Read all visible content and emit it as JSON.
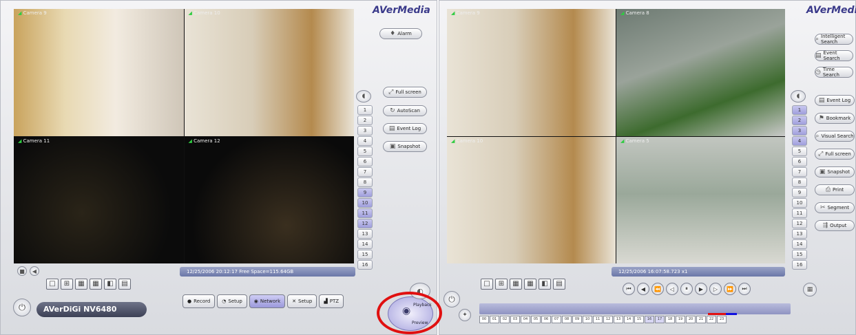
{
  "left": {
    "logo": "AVerMedia",
    "brand": "AVerDiGi NV6480",
    "alarm_label": "Alarm",
    "cameras": [
      "Camera 9",
      "Camera 10",
      "Camera 11",
      "Camera 12"
    ],
    "channels": [
      "1",
      "2",
      "3",
      "4",
      "5",
      "6",
      "7",
      "8",
      "9",
      "10",
      "11",
      "12",
      "13",
      "14",
      "15",
      "16"
    ],
    "side_buttons": [
      "Full screen",
      "AutoScan",
      "Event Log",
      "Snapshot"
    ],
    "status": "12/25/2006 20:12:17  Free Space=115.64GB",
    "tabs": [
      "Record",
      "Setup",
      "Network",
      "Setup",
      "PTZ"
    ],
    "mode_labels": [
      "Playback",
      "Preview"
    ]
  },
  "right": {
    "logo": "AVerMedia",
    "cameras": [
      "Camera 9",
      "Camera 8",
      "Camera 10",
      "Camera 5"
    ],
    "channels": [
      "1",
      "2",
      "3",
      "4",
      "5",
      "6",
      "7",
      "8",
      "9",
      "10",
      "11",
      "12",
      "13",
      "14",
      "15",
      "16"
    ],
    "top_buttons": [
      "Intelligent Search",
      "Event Search",
      "Time Search"
    ],
    "side_buttons": [
      "Event Log",
      "Bookmark",
      "Visual Search",
      "Full screen",
      "Snapshot",
      "Print",
      "Segment",
      "Output"
    ],
    "status": "12/25/2006 16:07:58.723   x1",
    "hours": [
      "00",
      "01",
      "02",
      "03",
      "04",
      "05",
      "06",
      "07",
      "08",
      "09",
      "10",
      "11",
      "12",
      "13",
      "14",
      "15",
      "16",
      "17",
      "18",
      "19",
      "20",
      "21",
      "22",
      "23"
    ]
  }
}
